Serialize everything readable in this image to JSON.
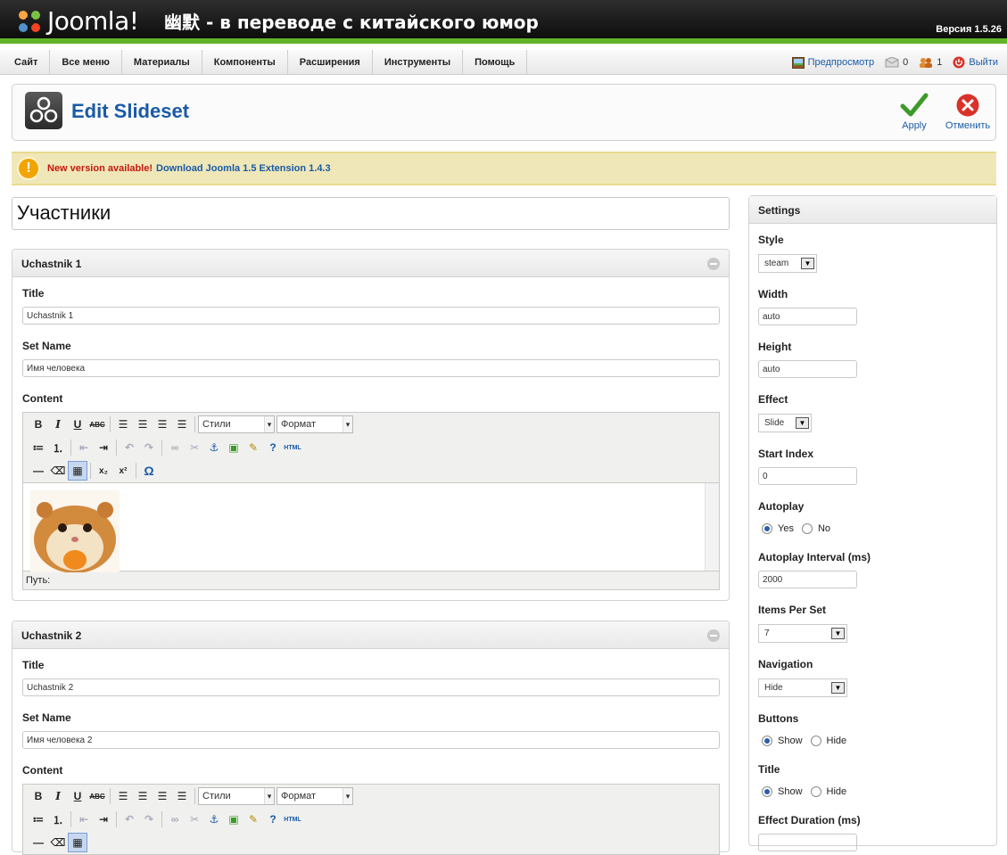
{
  "header": {
    "logo_text": "Joomla!",
    "site_title": "幽默 - в переводе с китайского юмор",
    "version": "Версия 1.5.26"
  },
  "menu": {
    "items": [
      "Сайт",
      "Все меню",
      "Материалы",
      "Компоненты",
      "Расширения",
      "Инструменты",
      "Помощь"
    ],
    "preview": "Предпросмотр",
    "messages_count": "0",
    "users_count": "1",
    "logout": "Выйти"
  },
  "toolbar": {
    "title": "Edit Slideset",
    "apply": "Apply",
    "cancel": "Отменить"
  },
  "notice": {
    "label": "New version available!",
    "link": "Download Joomla 1.5 Extension 1.4.3"
  },
  "slideset_title": "Участники",
  "editor": {
    "styles_label": "Стили",
    "format_label": "Формат",
    "path_label": "Путь:",
    "html_label": "HTML"
  },
  "slides": [
    {
      "header": "Uchastnik 1",
      "title_label": "Title",
      "title_value": "Uchastnik 1",
      "setname_label": "Set Name",
      "setname_value": "Имя человека",
      "content_label": "Content"
    },
    {
      "header": "Uchastnik 2",
      "title_label": "Title",
      "title_value": "Uchastnik 2",
      "setname_label": "Set Name",
      "setname_value": "Имя человека 2",
      "content_label": "Content"
    }
  ],
  "settings": {
    "header": "Settings",
    "style_label": "Style",
    "style_value": "steam",
    "width_label": "Width",
    "width_value": "auto",
    "height_label": "Height",
    "height_value": "auto",
    "effect_label": "Effect",
    "effect_value": "Slide",
    "start_index_label": "Start Index",
    "start_index_value": "0",
    "autoplay_label": "Autoplay",
    "autoplay_yes": "Yes",
    "autoplay_no": "No",
    "autoplay_selected": "Yes",
    "interval_label": "Autoplay Interval (ms)",
    "interval_value": "2000",
    "items_per_set_label": "Items Per Set",
    "items_per_set_value": "7",
    "navigation_label": "Navigation",
    "navigation_value": "Hide",
    "buttons_label": "Buttons",
    "buttons_show": "Show",
    "buttons_hide": "Hide",
    "buttons_selected": "Show",
    "title_label": "Title",
    "title_show": "Show",
    "title_hide": "Hide",
    "title_selected": "Show",
    "effect_duration_label": "Effect Duration (ms)"
  },
  "colors": {
    "accent_green": "#63b32a",
    "link_blue": "#1a5aa6",
    "notice_bg": "#efe7b8",
    "alert_red": "#c3180d"
  }
}
